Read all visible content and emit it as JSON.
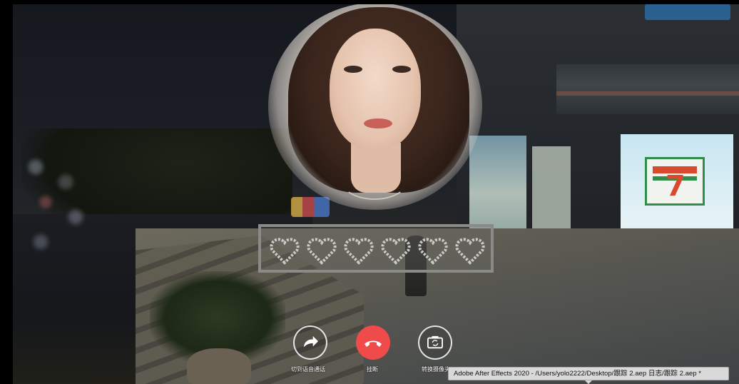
{
  "call": {
    "switch_voice_label": "切到语音通话",
    "hangup_label": "挂断",
    "switch_camera_label": "转换摄像头"
  },
  "icons": {
    "voice": "arrow-share-icon",
    "hangup": "phone-hangup-icon",
    "camera": "camera-switch-icon"
  },
  "colors": {
    "hangup_button": "#ef4b4b",
    "tooltip_bg": "#d9d9d9"
  },
  "tooltip": {
    "text": "Adobe After Effects 2020 - /Users/yolo2222/Desktop/跟踪 2.aep 日志/跟踪 2.aep *"
  }
}
